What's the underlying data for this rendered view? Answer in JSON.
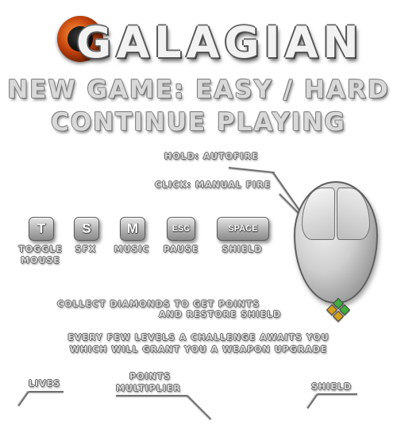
{
  "title": "GALAGIAN",
  "menu": {
    "new_game": "NEW GAME: EASY / HARD",
    "continue": "CONTINUE PLAYING"
  },
  "mouse_help": {
    "hold": "HOLD: AUTOFIRE",
    "click": "CLICK: MANUAL FIRE"
  },
  "keys": [
    {
      "key": "T",
      "label_line1": "TOGGLE",
      "label_line2": "MOUSE"
    },
    {
      "key": "S",
      "label_line1": "SFX",
      "label_line2": ""
    },
    {
      "key": "M",
      "label_line1": "MUSIC",
      "label_line2": ""
    },
    {
      "key": "ESC",
      "label_line1": "PAUSE",
      "label_line2": ""
    },
    {
      "key": "SPACE",
      "label_line1": "SHIELD",
      "label_line2": ""
    }
  ],
  "info": {
    "diamonds_line1": "COLLECT DIAMONDS TO GET POINTS",
    "diamonds_line2": "AND RESTORE SHIELD",
    "challenge_line1": "EVERY FEW LEVELS A CHALLENGE AWAITS YOU",
    "challenge_line2": "WHICH WILL GRANT YOU A WEAPON UPGRADE"
  },
  "hud": {
    "lives": "LIVES",
    "points_line1": "POINTS",
    "points_line2": "MULTIPLIER",
    "shield": "SHIELD"
  },
  "colors": {
    "background": "#ffffff",
    "chrome_text": "#d9d9d9",
    "logo_orange": "#c2410c",
    "diamond_green": "#3fae3f",
    "diamond_gold": "#d4a21a"
  }
}
